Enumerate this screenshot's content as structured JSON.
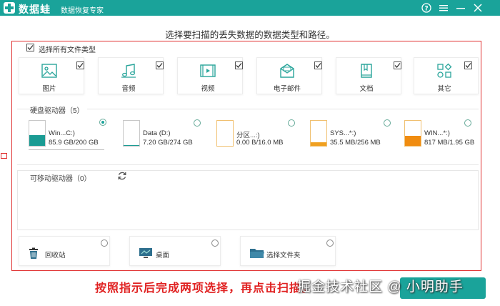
{
  "titlebar": {
    "app_name": "数据蛙",
    "subtitle": "数据恢复专家",
    "color": "#1aa39a",
    "icons": [
      "help-icon",
      "menu-icon",
      "minimize-icon",
      "close-icon"
    ]
  },
  "heading": "选择要扫描的丢失数据的数据类型和路径。",
  "select_all": {
    "label": "选择所有文件类型",
    "checked": true
  },
  "file_types": [
    {
      "label": "图片",
      "icon": "image-icon",
      "checked": true
    },
    {
      "label": "音频",
      "icon": "music-icon",
      "checked": true
    },
    {
      "label": "视频",
      "icon": "video-icon",
      "checked": true
    },
    {
      "label": "电子邮件",
      "icon": "email-icon",
      "checked": true
    },
    {
      "label": "文档",
      "icon": "document-icon",
      "checked": true
    },
    {
      "label": "其它",
      "icon": "other-icon",
      "checked": true
    }
  ],
  "hard_drives": {
    "title": "硬盘驱动器（5）",
    "items": [
      {
        "name": "Win...C:)",
        "size": "85.9 GB/200 GB",
        "used_fraction": 0.43,
        "fill_color": "#1a9b93",
        "selected": true
      },
      {
        "name": "Data (D:)",
        "size": "7.20 GB/274 GB",
        "used_fraction": 0.03,
        "fill_color": "#1a9b93",
        "selected": false
      },
      {
        "name": "分区...:)",
        "size": "0.00  B/16.0 MB",
        "used_fraction": 0.0,
        "fill_color": "#f0a020",
        "selected": false
      },
      {
        "name": "SYS...*:)",
        "size": "35.5 MB/256 MB",
        "used_fraction": 0.14,
        "fill_color": "#f0a020",
        "selected": false
      },
      {
        "name": "WIN...*:)",
        "size": "817 MB/1.95 GB",
        "used_fraction": 0.41,
        "fill_color": "#f08c10",
        "selected": false
      }
    ]
  },
  "removable": {
    "title": "可移动驱动器（0）"
  },
  "locations": [
    {
      "label": "回收站",
      "icon": "recycle-bin-icon"
    },
    {
      "label": "桌面",
      "icon": "desktop-icon"
    },
    {
      "label": "选择文件夹",
      "icon": "folder-icon"
    }
  ],
  "annotation_text": "按照指示后完成两项选择，再点击扫描。",
  "watermark": "掘金技术社区 @ 小明助手",
  "accent_red": "#e03030"
}
